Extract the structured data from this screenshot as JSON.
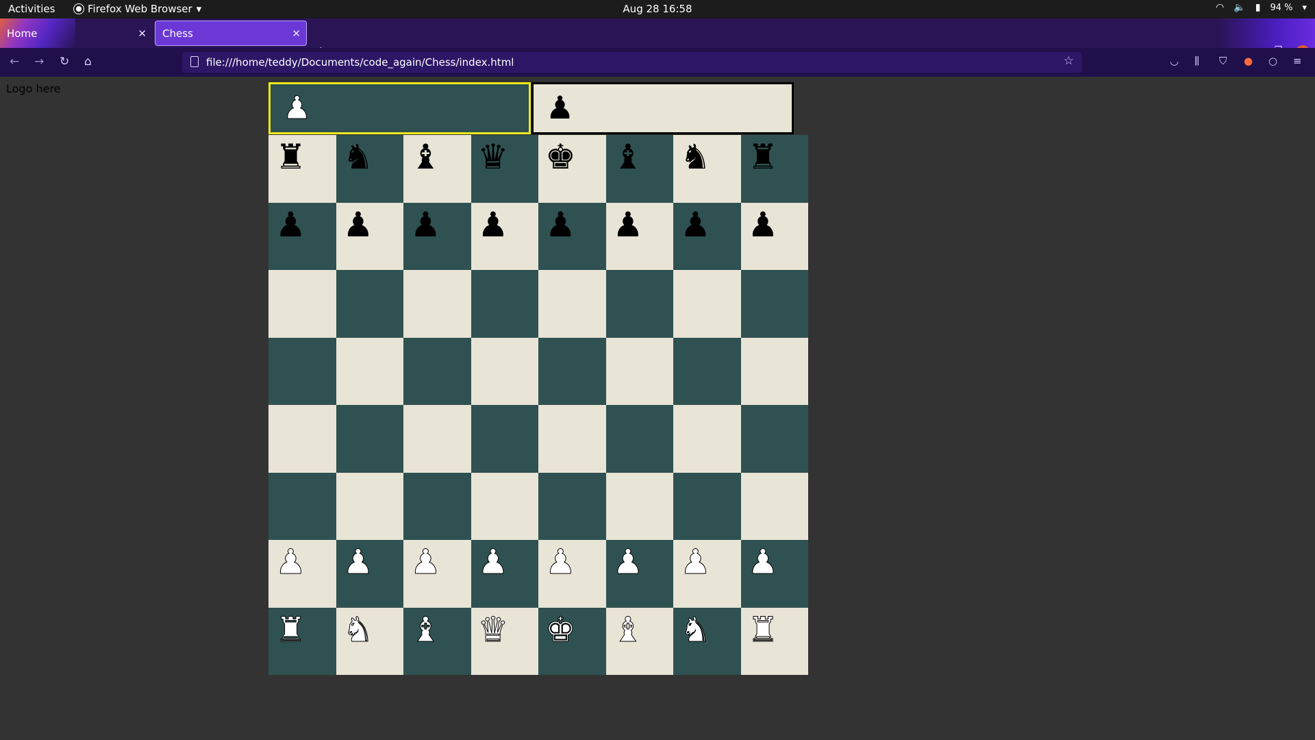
{
  "topbar": {
    "activities": "Activities",
    "app_name": "Firefox Web Browser",
    "clock": "Aug 28  16:58",
    "battery": "94 %"
  },
  "browser": {
    "tabs": [
      {
        "label": "Home",
        "active": false
      },
      {
        "label": "Chess",
        "active": true
      }
    ],
    "url": "file:///home/teddy/Documents/code_again/Chess/index.html"
  },
  "page": {
    "logo_text": "Logo here",
    "player1": {
      "piece": "♟",
      "piece_color": "white",
      "highlighted": true
    },
    "player2": {
      "piece": "♟",
      "piece_color": "black",
      "highlighted": false
    },
    "board": {
      "light_color": "#e8e4d6",
      "dark_color": "#2f5151",
      "ranks": [
        [
          {
            "g": "♜",
            "c": "black"
          },
          {
            "g": "♞",
            "c": "black"
          },
          {
            "g": "♝",
            "c": "black"
          },
          {
            "g": "♛",
            "c": "black"
          },
          {
            "g": "♚",
            "c": "black"
          },
          {
            "g": "♝",
            "c": "black"
          },
          {
            "g": "♞",
            "c": "black"
          },
          {
            "g": "♜",
            "c": "black"
          }
        ],
        [
          {
            "g": "♟",
            "c": "black"
          },
          {
            "g": "♟",
            "c": "black"
          },
          {
            "g": "♟",
            "c": "black"
          },
          {
            "g": "♟",
            "c": "black"
          },
          {
            "g": "♟",
            "c": "black"
          },
          {
            "g": "♟",
            "c": "black"
          },
          {
            "g": "♟",
            "c": "black"
          },
          {
            "g": "♟",
            "c": "black"
          }
        ],
        [
          null,
          null,
          null,
          null,
          null,
          null,
          null,
          null
        ],
        [
          null,
          null,
          null,
          null,
          null,
          null,
          null,
          null
        ],
        [
          null,
          null,
          null,
          null,
          null,
          null,
          null,
          null
        ],
        [
          null,
          null,
          null,
          null,
          null,
          null,
          null,
          null
        ],
        [
          {
            "g": "♟",
            "c": "white"
          },
          {
            "g": "♟",
            "c": "white"
          },
          {
            "g": "♟",
            "c": "white"
          },
          {
            "g": "♟",
            "c": "white"
          },
          {
            "g": "♟",
            "c": "white"
          },
          {
            "g": "♟",
            "c": "white"
          },
          {
            "g": "♟",
            "c": "white"
          },
          {
            "g": "♟",
            "c": "white"
          }
        ],
        [
          {
            "g": "♜",
            "c": "white"
          },
          {
            "g": "♞",
            "c": "white"
          },
          {
            "g": "♝",
            "c": "white"
          },
          {
            "g": "♛",
            "c": "white"
          },
          {
            "g": "♚",
            "c": "white"
          },
          {
            "g": "♝",
            "c": "white"
          },
          {
            "g": "♞",
            "c": "white"
          },
          {
            "g": "♜",
            "c": "white"
          }
        ]
      ]
    }
  }
}
